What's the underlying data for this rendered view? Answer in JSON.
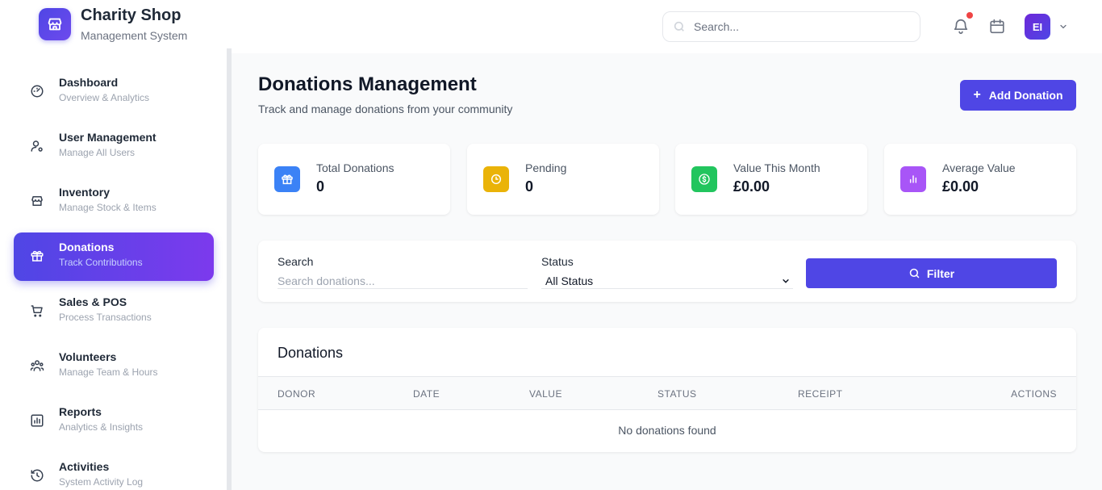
{
  "brand": {
    "title": "Charity Shop",
    "subtitle": "Management System"
  },
  "header": {
    "search_placeholder": "Search...",
    "avatar_initials": "EI"
  },
  "sidebar": {
    "items": [
      {
        "title": "Dashboard",
        "subtitle": "Overview & Analytics",
        "icon": "gauge-icon"
      },
      {
        "title": "User Management",
        "subtitle": "Manage All Users",
        "icon": "user-gear-icon"
      },
      {
        "title": "Inventory",
        "subtitle": "Manage Stock & Items",
        "icon": "store-icon"
      },
      {
        "title": "Donations",
        "subtitle": "Track Contributions",
        "icon": "gift-icon",
        "active": true
      },
      {
        "title": "Sales & POS",
        "subtitle": "Process Transactions",
        "icon": "cart-icon"
      },
      {
        "title": "Volunteers",
        "subtitle": "Manage Team & Hours",
        "icon": "people-icon"
      },
      {
        "title": "Reports",
        "subtitle": "Analytics & Insights",
        "icon": "chart-icon"
      },
      {
        "title": "Activities",
        "subtitle": "System Activity Log",
        "icon": "history-icon"
      }
    ]
  },
  "page": {
    "title": "Donations Management",
    "subtitle": "Track and manage donations from your community",
    "add_button": "Add Donation"
  },
  "stats": [
    {
      "label": "Total Donations",
      "value": "0",
      "color": "#3b82f6",
      "icon": "gift-icon"
    },
    {
      "label": "Pending",
      "value": "0",
      "color": "#eab308",
      "icon": "clock-icon"
    },
    {
      "label": "Value This Month",
      "value": "£0.00",
      "color": "#22c55e",
      "icon": "dollar-icon"
    },
    {
      "label": "Average Value",
      "value": "£0.00",
      "color": "#a855f7",
      "icon": "bar-chart-icon"
    }
  ],
  "filters": {
    "search_label": "Search",
    "search_placeholder": "Search donations...",
    "status_label": "Status",
    "status_value": "All Status",
    "filter_button": "Filter"
  },
  "table": {
    "title": "Donations",
    "columns": [
      "DONOR",
      "DATE",
      "VALUE",
      "STATUS",
      "RECEIPT",
      "ACTIONS"
    ],
    "empty_message": "No donations found"
  },
  "colors": {
    "accent": "#4f46e5",
    "notification": "#ef4444"
  }
}
